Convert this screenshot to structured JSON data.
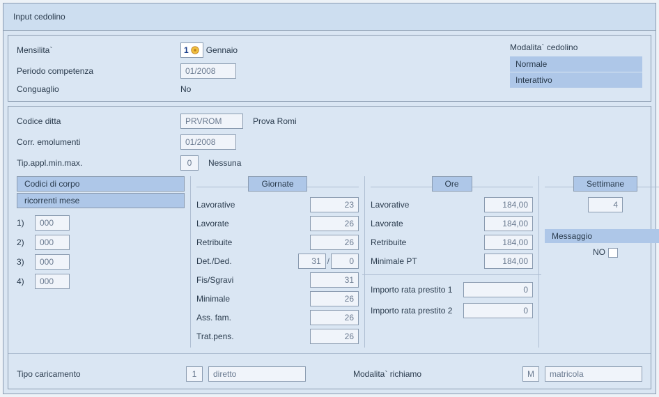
{
  "title": "Input cedolino",
  "top": {
    "mensilita_label": "Mensilita`",
    "mensilita_num": "1",
    "mensilita_month": "Gennaio",
    "periodo_label": "Periodo competenza",
    "periodo_val": "01/2008",
    "conguaglio_label": "Conguaglio",
    "conguaglio_val": "No",
    "modalita_label": "Modalita` cedolino",
    "modalita_opts": [
      "Normale",
      "Interattivo"
    ]
  },
  "company": {
    "codice_label": "Codice ditta",
    "codice_val": "PRVROM",
    "codice_desc": "Prova Romi",
    "corr_label": "Corr. emolumenti",
    "corr_val": "01/2008",
    "tip_label": "Tip.appl.min.max.",
    "tip_val": "0",
    "tip_desc": "Nessuna"
  },
  "codici": {
    "tab1": "Codici di corpo",
    "tab2": "ricorrenti mese",
    "rows": [
      {
        "n": "1)",
        "v": "000"
      },
      {
        "n": "2)",
        "v": "000"
      },
      {
        "n": "3)",
        "v": "000"
      },
      {
        "n": "4)",
        "v": "000"
      }
    ]
  },
  "giornate": {
    "tab": "Giornate",
    "lavorative": {
      "l": "Lavorative",
      "v": "23"
    },
    "lavorate": {
      "l": "Lavorate",
      "v": "26"
    },
    "retribuite": {
      "l": "Retribuite",
      "v": "26"
    },
    "detded": {
      "l": "Det./Ded.",
      "a": "31",
      "b": "0"
    },
    "fis": {
      "l": "Fis/Sgravi",
      "v": "31"
    },
    "minimale": {
      "l": "Minimale",
      "v": "26"
    },
    "assfam": {
      "l": "Ass. fam.",
      "v": "26"
    },
    "tratpens": {
      "l": "Trat.pens.",
      "v": "26"
    }
  },
  "ore": {
    "tab": "Ore",
    "lavorative": {
      "l": "Lavorative",
      "v": "184,00"
    },
    "lavorate": {
      "l": "Lavorate",
      "v": "184,00"
    },
    "retribuite": {
      "l": "Retribuite",
      "v": "184,00"
    },
    "minpt": {
      "l": "Minimale PT",
      "v": "184,00"
    }
  },
  "settimane": {
    "tab": "Settimane",
    "v": "4"
  },
  "messaggio": {
    "h": "Messaggio",
    "v": "NO"
  },
  "loan": {
    "l1": "Importo rata prestito 1",
    "v1": "0",
    "l2": "Importo rata prestito 2",
    "v2": "0"
  },
  "bottom": {
    "tipo_label": "Tipo caricamento",
    "tipo_code": "1",
    "tipo_desc": "diretto",
    "mod_label": "Modalita` richiamo",
    "mod_code": "M",
    "mod_desc": "matricola"
  }
}
